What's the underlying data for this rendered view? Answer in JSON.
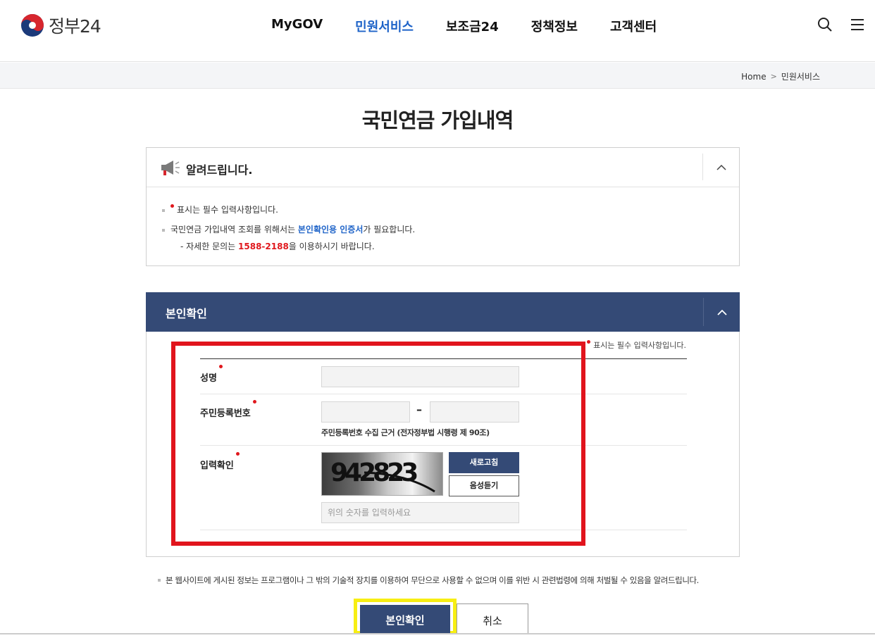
{
  "header": {
    "logo_text": "정부24",
    "nav": [
      "MyGOV",
      "민원서비스",
      "보조금24",
      "정책정보",
      "고객센터"
    ],
    "active_nav": "민원서비스",
    "icons": [
      "search-icon",
      "menu-icon"
    ]
  },
  "breadcrumb": {
    "home": "Home",
    "current": "민원서비스"
  },
  "page": {
    "title": "국민연금 가입내역"
  },
  "notice": {
    "title": "알려드립니다.",
    "line1_suffix": "표시는 필수 입력사항입니다.",
    "line2_prefix": "국민연금 가입내역 조회를 위해서는 ",
    "line2_highlight": "본인확인용 인증서",
    "line2_suffix": "가 필요합니다.",
    "line3_prefix": "- 자세한 문의는 ",
    "line3_phone": "1588-2188",
    "line3_suffix": "을 이용하시기 바랍니다."
  },
  "auth": {
    "title": "본인확인",
    "required_note": "표시는 필수 입력사항입니다.",
    "name_label": "성명",
    "name_value": "",
    "rrn_label": "주민등록번호",
    "rrn_front": "",
    "rrn_back": "",
    "rrn_dash": "–",
    "rrn_note": "주민등록번호 수집 근거 (전자정부법 시행령 제 90조)",
    "captcha_label": "입력확인",
    "captcha_text": "942823",
    "refresh_label": "새로고침",
    "audio_label": "음성듣기",
    "captcha_placeholder": "위의 숫자를 입력하세요"
  },
  "disclaimer": "본 웹사이트에 게시된 정보는 프로그램이나 그 밖의 기술적 장치를 이용하여 무단으로 사용할 수 없으며 이를 위반 시 관련법령에 의해 처벌될 수 있음을 알려드립니다.",
  "buttons": {
    "confirm": "본인확인",
    "cancel": "취소"
  },
  "colors": {
    "accent": "#344a76",
    "active_nav": "#1e63c8",
    "required": "#e0181d",
    "highlight_frame": "#e1141d",
    "button_frame": "#f7ee13"
  }
}
